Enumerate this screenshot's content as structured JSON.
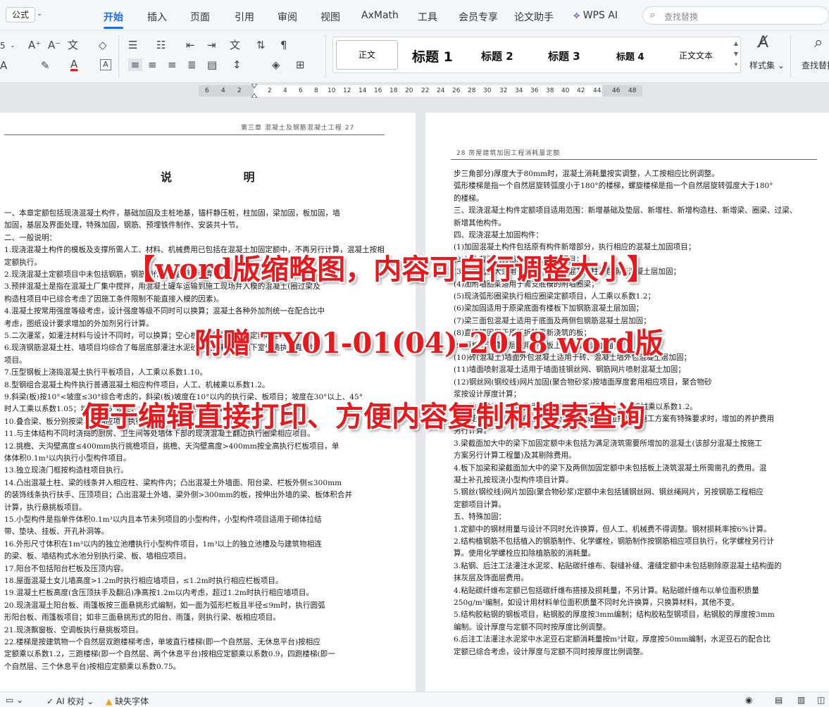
{
  "topbar": {
    "style_pill": "公式",
    "tabs": [
      "开始",
      "插入",
      "页面",
      "引用",
      "审阅",
      "视图",
      "AxMath",
      "工具",
      "会员专享",
      "论文助手"
    ],
    "active_tab": "开始",
    "wps_ai": "WPS AI",
    "search_placeholder": "查找替换"
  },
  "ribbon": {
    "styles": [
      "正文",
      "标题 1",
      "标题 2",
      "标题 3",
      "标题 4",
      "正文文本"
    ],
    "style_set_label": "样式集",
    "find_replace_label": "查找替换",
    "font_size_partial": "5"
  },
  "ruler": {
    "ticks": [
      "6",
      "4",
      "2",
      "2",
      "4",
      "6",
      "8",
      "10",
      "12",
      "14",
      "16",
      "18",
      "20",
      "22",
      "24",
      "26",
      "28",
      "30",
      "32",
      "34",
      "36",
      "38",
      "40",
      "42",
      "44",
      "46",
      "48"
    ]
  },
  "page_left": {
    "header": "第三章  混凝土及钢筋混凝土工程    27",
    "title": "说  明",
    "lines": [
      "一、本章定额包括现浇混凝土构件，基础加固及主桩地基，锚杆静压桩，柱加固，梁加固，板加固，墙",
      "加固，基层及界面处理，特殊加固，钢筋、预埋铁件制作、安装共十节。",
      "二、一般说明：",
      "1.现浇混凝土构件的模板及支撑所需人工、材料、机械费用已包括在混凝土加固定额中，不再另行计算，混凝土按相应",
      "定额执行。",
      "2.现浇混凝土定额项目中未包括钢筋，钢筋制作、安装另行计算。",
      "3.预拌混凝土是指在混凝土厂集中搅拌，用混凝土罐车运输到施工现场并入模的混凝土(圈过梁及",
      "构造柱项目中已综合考虑了因施工条件限制不能直接入模的因素)。",
      "4.混凝土按常用强度等级考虑，设计强度等级不同时可以换算；混凝土各种外加剂统一在配合比中",
      "考虑，图纸设计要求增加的外加剂另行计算。",
      "5.二次灌浆，如灌注材料与设计不同时，可以换算；空心板内灌缝已包括在定额项目中。",
      "6.现浇钢筋混凝土柱、墙项目均综合了每层底部灌注水泥砂浆的消耗量。地下室外墙执行直形墙",
      "项目。",
      "7.压型钢板上浇捣混凝土执行平板项目，人工乘以系数1.10。",
      "8.型钢组合混凝土构件执行普通混凝土相应构件项目，人工、机械乘以系数1.2。",
      "9.斜梁(板)按10°<坡度≤30°综合考虑的，斜梁(板)坡度在10°以内的执行梁、板项目；坡度在30°以上、45°",
      "时人工乘以系数1.05；坡度在45°以上、60°以内时人工乘以系数1.10。",
      "10.叠合梁、板分别按梁、板相应项目执行。",
      "11.与主体结构不同时浇捣的厨房、卫生间等处墙体下部的现浇混凝土翻边执行圈梁相应项目。",
      "12.挑檐、天沟壁高度≤400mm执行挑檐项目，挑檐、天沟壁高度>400mm按全高执行栏板项目，单",
      "体体积0.1m³以内执行小型构件项目。",
      "13.独立现浇门框按构造柱项目执行。",
      "14.凸出混凝土柱、梁的线条并入相应柱、梁构件内；凸出混凝土外墙面、阳台梁、栏板外侧≤300mm",
      "的装饰线条执行扶手、压顶项目；凸出混凝土外墙、梁外侧>300mm的板，按伸出外墙的梁、板体积合并",
      "计算，执行悬挑板项目。",
      "15.小型构件是指单件体积0.1m³以内且本节未列项目的小型构件，小型构件项目适用于砌体拉结",
      "带、垫块、挂板、开孔补洞等。",
      "16.外形尺寸体积在1m³以内的独立池槽执行小型构件项目，1m³以上的独立池槽及与建筑物相连",
      "的梁、板、墙结构式水池分别执行梁、板、墙相应项目。",
      "17.阳台不包括阳台栏板及压顶内容。",
      "18.屋面混凝土女儿墙高度>1.2m时执行相应墙项目，≤1.2m时执行相应栏板项目。",
      "19.混凝土栏板高度(含压顶扶手及翻沿)净高按1.2m以内考虑，超过1.2m时执行相应墙项目。",
      "20.现浇混凝土阳台板、雨篷板按三面悬挑形式编制，如一面为弧形栏板且半径≤9m时，执行圆弧",
      "形阳台板、雨篷板项目；如非三面悬挑形式的阳台、雨篷，则执行梁、板相应项目。",
      "21.现浇飘窗板、空调板执行悬挑板项目。",
      "22.楼梯是按建筑物一个自然层双跑楼梯考虑，单坡直行楼梯(即一个自然层、无休息平台)按相应",
      "定额乘以系数1.2，三跑楼梯(即一个自然层、两个休息平台)按相应定额乘以系数0.9，四跑楼梯(即一",
      "个自然层、三个休息平台)按相应定额乘以系数0.75。"
    ]
  },
  "page_right": {
    "header": "28    房屋建筑加固工程消耗量定额",
    "lines": [
      "步三角部分)厚度大于80mm时，混凝土消耗量按实调整，人工按相应比例调整。",
      "弧形楼梯是指一个自然层旋转弧度小于180°的楼梯，螺旋楼梯是指一个自然层旋转弧度大于180°",
      "的楼梯。",
      "三、现浇混凝土构件定额项目适用范围：新增基础及垫层、新增柱、新增构造柱、新增梁、圈梁、过梁、",
      "新增其他构件。",
      "四、现浇混凝土加固构件：",
      "(1)加固混凝土构件包括原有构件新增部分，执行相应的混凝土加固项目；",
      "(2)加大截面执行相应外包混凝土项目；",
      "(3)柱截面加大适用于独立的砖柱、混凝土柱外包钢筋混凝土层加固；",
      "(4)加附墙圈梁适用于需支底模的附墙圈梁；",
      "(5)现浇弧形圈梁执行相应圈梁定额项目，人工乘以系数1.2；",
      "(6)梁加固适用于原梁底面有楼板下加钢筋混凝土层加固；",
      "(7)梁三面包混凝土适用于底面及两侧包钢筋混凝土层加固；",
      "(8)直接锚固用于原板拆除重新浇筑的板；",
      "(9)原板上浇叠合层适用于原板上加混凝土层加固；",
      "(10)砖(混凝土)墙面外包混凝土适用于砖、混凝土墙外包混凝土层加固；",
      "(11)墙面喷射混凝土适用于墙面挂钢丝网、钢筋网片喷射混凝土加固；",
      "(12)钢丝网(钢绞线)网片加固(聚合物砂浆)按墙面厚度套用相应项目，聚合物砂",
      "浆按设计厚度计算；",
      "(13)独立柱套混凝土项目执行相应加固柱项目，人工、机械乘以系数1.2。",
      "2.混凝土是按自然养护编制的，设计或经建设单位批准的施工方案有特殊要求时，增加的养护费用",
      "另行计算。",
      "3.梁截面加大中的梁下加固定额中未包括为满足浇筑需要所增加的混凝土(该部分混凝土按施工",
      "方案另行计算工程量)及其剔除费用。",
      "4.板下加梁和梁截面加大中的梁下及两侧加固定额中未包括板上浇筑混凝土所需凿孔的费用。混",
      "凝土补孔按现浇小型构件项目计算。",
      "5.钢丝(钢绞线)网片加固(聚合物砂浆)定额中未包括铺钢丝网、钢丝绳网片，另按钢筋工程相应",
      "定额项目计算。",
      "五、特殊加固：",
      "1.定额中的钢材用量与设计不同时允许换算，但人工、机械费不得调整。钢材损耗率按6%计算。",
      "2.结构植钢筋不包括植入的钢筋制作、化学螺栓，钢筋制作按钢筋相应项目执行，化学螺栓另行计",
      "算。使用化学螺栓应扣除植筋胶的消耗量。",
      "3.粘钢、后注工法灌注水泥浆、粘贴碳纤维布、裂缝补缝、灌缝定额中未包括剔除原混凝土结构面的",
      "抹灰层及饰面层费用。",
      "4.粘贴碳纤维布定额已包括碳纤维布搭接及损耗量，不另计算。粘贴碳纤维布以单位面积质量",
      "250g/m²编制，如设计用材料单位面积质量不同时允许换算，只换算材料，其他不变。",
      "5.结构胶粘钢的钢板项目，粘钢胶的厚度按3mm编制；结构胶粘型钢项目，粘钢胶的厚度按3mm",
      "编制。设计厚度与定额不同时按厚度比例调整。",
      "6.后注工法灌注水泥浆中水泥豆石定额消耗量按m³计取，厚度按50mm编制，水泥豆石的配合比",
      "定额已综合考虑，设计厚度与定额不同时按厚度比例调整。"
    ]
  },
  "overlay": {
    "line1": "【word版缩略图，内容可自行调整大小】",
    "line2": "附赠 TY01-01(04)-2018 word版",
    "line3": "便于编辑直接打印、方便内容复制和搜索查询"
  },
  "statusbar": {
    "ai_check": "AI 校对",
    "missing_fonts": "缺失字体"
  },
  "colors": {
    "accent": "#1a6cf0",
    "overlay_red": "#e8191c",
    "font_color_red": "#e02020",
    "warning": "#e8a317"
  }
}
